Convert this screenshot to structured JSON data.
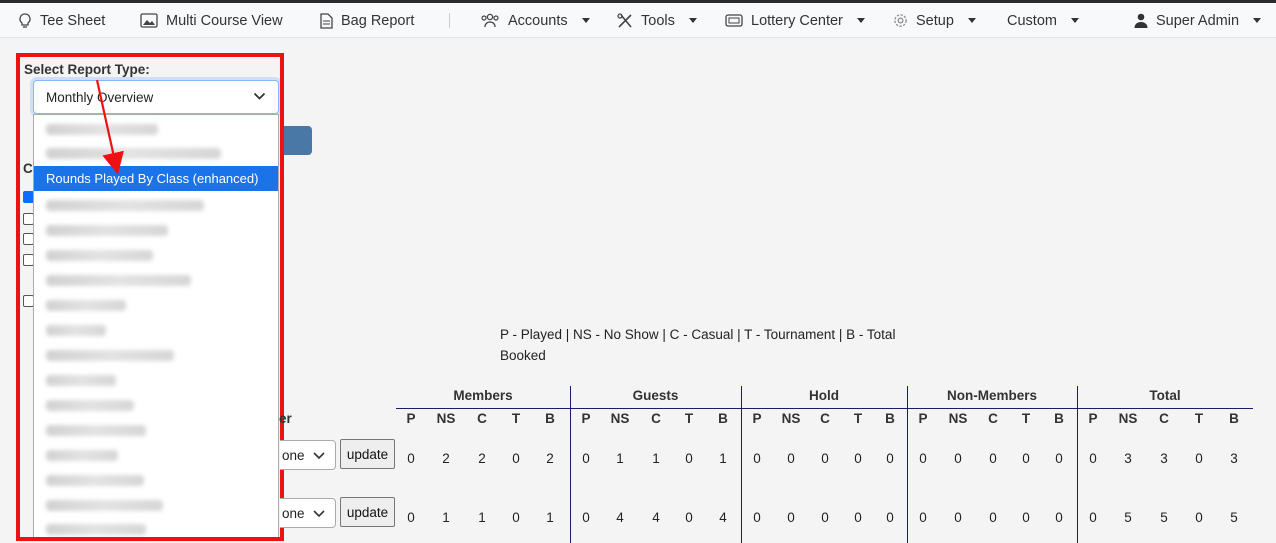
{
  "nav": {
    "items": [
      {
        "label": "Tee Sheet",
        "icon": "lightbulb-icon",
        "caret": false
      },
      {
        "label": "Multi Course View",
        "icon": "image-icon",
        "caret": false
      },
      {
        "label": "Bag Report",
        "icon": "document-icon",
        "caret": false
      },
      {
        "label": "Accounts",
        "icon": "users-icon",
        "caret": true
      },
      {
        "label": "Tools",
        "icon": "tools-icon",
        "caret": true
      },
      {
        "label": "Lottery Center",
        "icon": "ticket-icon",
        "caret": true
      },
      {
        "label": "Setup",
        "icon": "gear-icon",
        "caret": true
      },
      {
        "label": "Custom",
        "icon": "",
        "caret": true
      },
      {
        "label": "Super Admin",
        "icon": "user-icon",
        "caret": true
      }
    ]
  },
  "report": {
    "label": "Select Report Type:",
    "selected_value": "Monthly Overview",
    "highlighted_option": "Rounds Played By Class (enhanced)"
  },
  "legend": "P - Played | NS - No Show | C - Casual | T - Tournament | B - Total Booked",
  "partial": {
    "column_fragment": "er",
    "left_fragment": "C",
    "select_fragment": "one"
  },
  "table": {
    "groups": [
      "Members",
      "Guests",
      "Hold",
      "Non-Members",
      "Total"
    ],
    "subcols": [
      "P",
      "NS",
      "C",
      "T",
      "B"
    ],
    "update_label": "update",
    "rows": [
      [
        [
          0,
          2,
          2,
          0,
          2
        ],
        [
          0,
          1,
          1,
          0,
          1
        ],
        [
          0,
          0,
          0,
          0,
          0
        ],
        [
          0,
          0,
          0,
          0,
          0
        ],
        [
          0,
          3,
          3,
          0,
          3
        ]
      ],
      [
        [
          0,
          1,
          1,
          0,
          1
        ],
        [
          0,
          4,
          4,
          0,
          4
        ],
        [
          0,
          0,
          0,
          0,
          0
        ],
        [
          0,
          0,
          0,
          0,
          0
        ],
        [
          0,
          5,
          5,
          0,
          5
        ]
      ]
    ]
  },
  "colors": {
    "highlight": "#1a73e8",
    "annotation_red": "#ee1111",
    "table_divider": "#1a1a6e"
  }
}
